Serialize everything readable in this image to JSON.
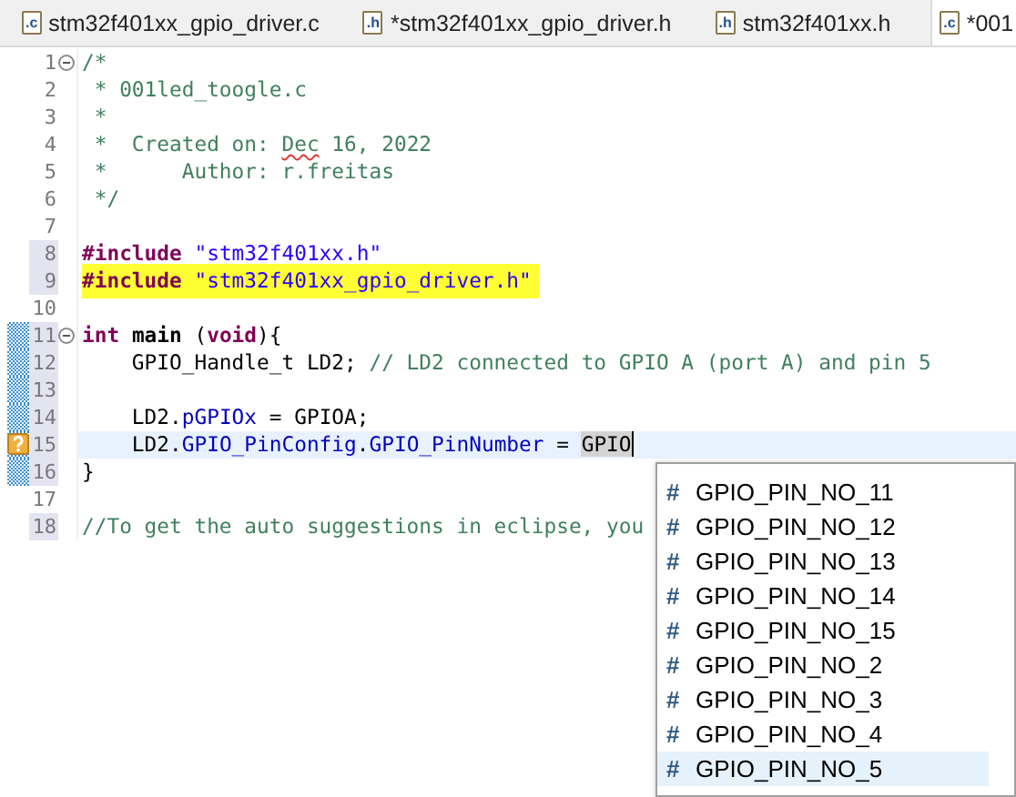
{
  "tabs": [
    {
      "icon": ".c",
      "label": "stm32f401xx_gpio_driver.c",
      "selected": false
    },
    {
      "icon": ".h",
      "label": "*stm32f401xx_gpio_driver.h",
      "selected": false
    },
    {
      "icon": ".h",
      "label": "stm32f401xx.h",
      "selected": false
    },
    {
      "icon": ".c",
      "label": "*001",
      "selected": true
    }
  ],
  "editor": {
    "lines": [
      {
        "number": "1",
        "fold": true,
        "segments": [
          {
            "kind": "comment",
            "text": "/*"
          }
        ]
      },
      {
        "number": "2",
        "segments": [
          {
            "kind": "comment",
            "text": " * 001led_toogle.c"
          }
        ]
      },
      {
        "number": "3",
        "segments": [
          {
            "kind": "comment",
            "text": " *"
          }
        ]
      },
      {
        "number": "4",
        "segments": [
          {
            "kind": "comment",
            "text": " *  Created on: "
          },
          {
            "kind": "misspelled",
            "text": "Dec"
          },
          {
            "kind": "comment",
            "text": " 16, 2022"
          }
        ]
      },
      {
        "number": "5",
        "segments": [
          {
            "kind": "comment",
            "text": " *      Author: r.freitas"
          }
        ]
      },
      {
        "number": "6",
        "segments": [
          {
            "kind": "comment",
            "text": " */"
          }
        ]
      },
      {
        "number": "7"
      },
      {
        "number": "8",
        "changed": true,
        "segments": [
          {
            "kind": "preprocessor",
            "text": "#include "
          },
          {
            "kind": "string",
            "text": "\"stm32f401xx.h\""
          }
        ]
      },
      {
        "number": "9",
        "changed": true,
        "highlighted": true,
        "segments": [
          {
            "kind": "preprocessor",
            "text": "#include "
          },
          {
            "kind": "string",
            "text": "\"stm32f401xx_gpio_driver.h\""
          }
        ]
      },
      {
        "number": "10"
      },
      {
        "number": "11",
        "fold": true,
        "changed": true,
        "added": true,
        "segments": [
          {
            "kind": "keyword",
            "text": "int "
          },
          {
            "kind": "bold",
            "text": "main"
          },
          {
            "kind": "plain",
            "text": " ("
          },
          {
            "kind": "keyword",
            "text": "void"
          },
          {
            "kind": "plain",
            "text": "){"
          }
        ]
      },
      {
        "number": "12",
        "changed": true,
        "added": true,
        "segments": [
          {
            "kind": "plain",
            "text": "    GPIO_Handle_t LD2; "
          },
          {
            "kind": "comment",
            "text": "// LD2 connected to GPIO A (port A) and pin 5"
          }
        ]
      },
      {
        "number": "13",
        "changed": true,
        "added": true
      },
      {
        "number": "14",
        "changed": true,
        "added": true,
        "segments": [
          {
            "kind": "plain",
            "text": "    LD2."
          },
          {
            "kind": "field",
            "text": "pGPIOx"
          },
          {
            "kind": "plain",
            "text": " = GPIOA;"
          }
        ]
      },
      {
        "number": "15",
        "changed": true,
        "added": true,
        "warning": true,
        "current": true,
        "segments": [
          {
            "kind": "plain",
            "text": "    LD2."
          },
          {
            "kind": "field",
            "text": "GPIO_PinConfig"
          },
          {
            "kind": "plain",
            "text": "."
          },
          {
            "kind": "field",
            "text": "GPIO_PinNumber"
          },
          {
            "kind": "plain",
            "text": " = "
          },
          {
            "kind": "selected",
            "text": "GPIO"
          }
        ]
      },
      {
        "number": "16",
        "changed": true,
        "added": true,
        "segments": [
          {
            "kind": "plain",
            "text": "}"
          }
        ]
      },
      {
        "number": "17"
      },
      {
        "number": "18",
        "changed": true,
        "segments": [
          {
            "kind": "comment",
            "text": "//To get the auto suggestions in eclipse, you"
          }
        ]
      }
    ]
  },
  "suggestions": [
    {
      "icon": "#",
      "label": "GPIO_PIN_NO_11",
      "selected": false
    },
    {
      "icon": "#",
      "label": "GPIO_PIN_NO_12",
      "selected": false
    },
    {
      "icon": "#",
      "label": "GPIO_PIN_NO_13",
      "selected": false
    },
    {
      "icon": "#",
      "label": "GPIO_PIN_NO_14",
      "selected": false
    },
    {
      "icon": "#",
      "label": "GPIO_PIN_NO_15",
      "selected": false
    },
    {
      "icon": "#",
      "label": "GPIO_PIN_NO_2",
      "selected": false
    },
    {
      "icon": "#",
      "label": "GPIO_PIN_NO_3",
      "selected": false
    },
    {
      "icon": "#",
      "label": "GPIO_PIN_NO_4",
      "selected": false
    },
    {
      "icon": "#",
      "label": "GPIO_PIN_NO_5",
      "selected": true
    }
  ]
}
